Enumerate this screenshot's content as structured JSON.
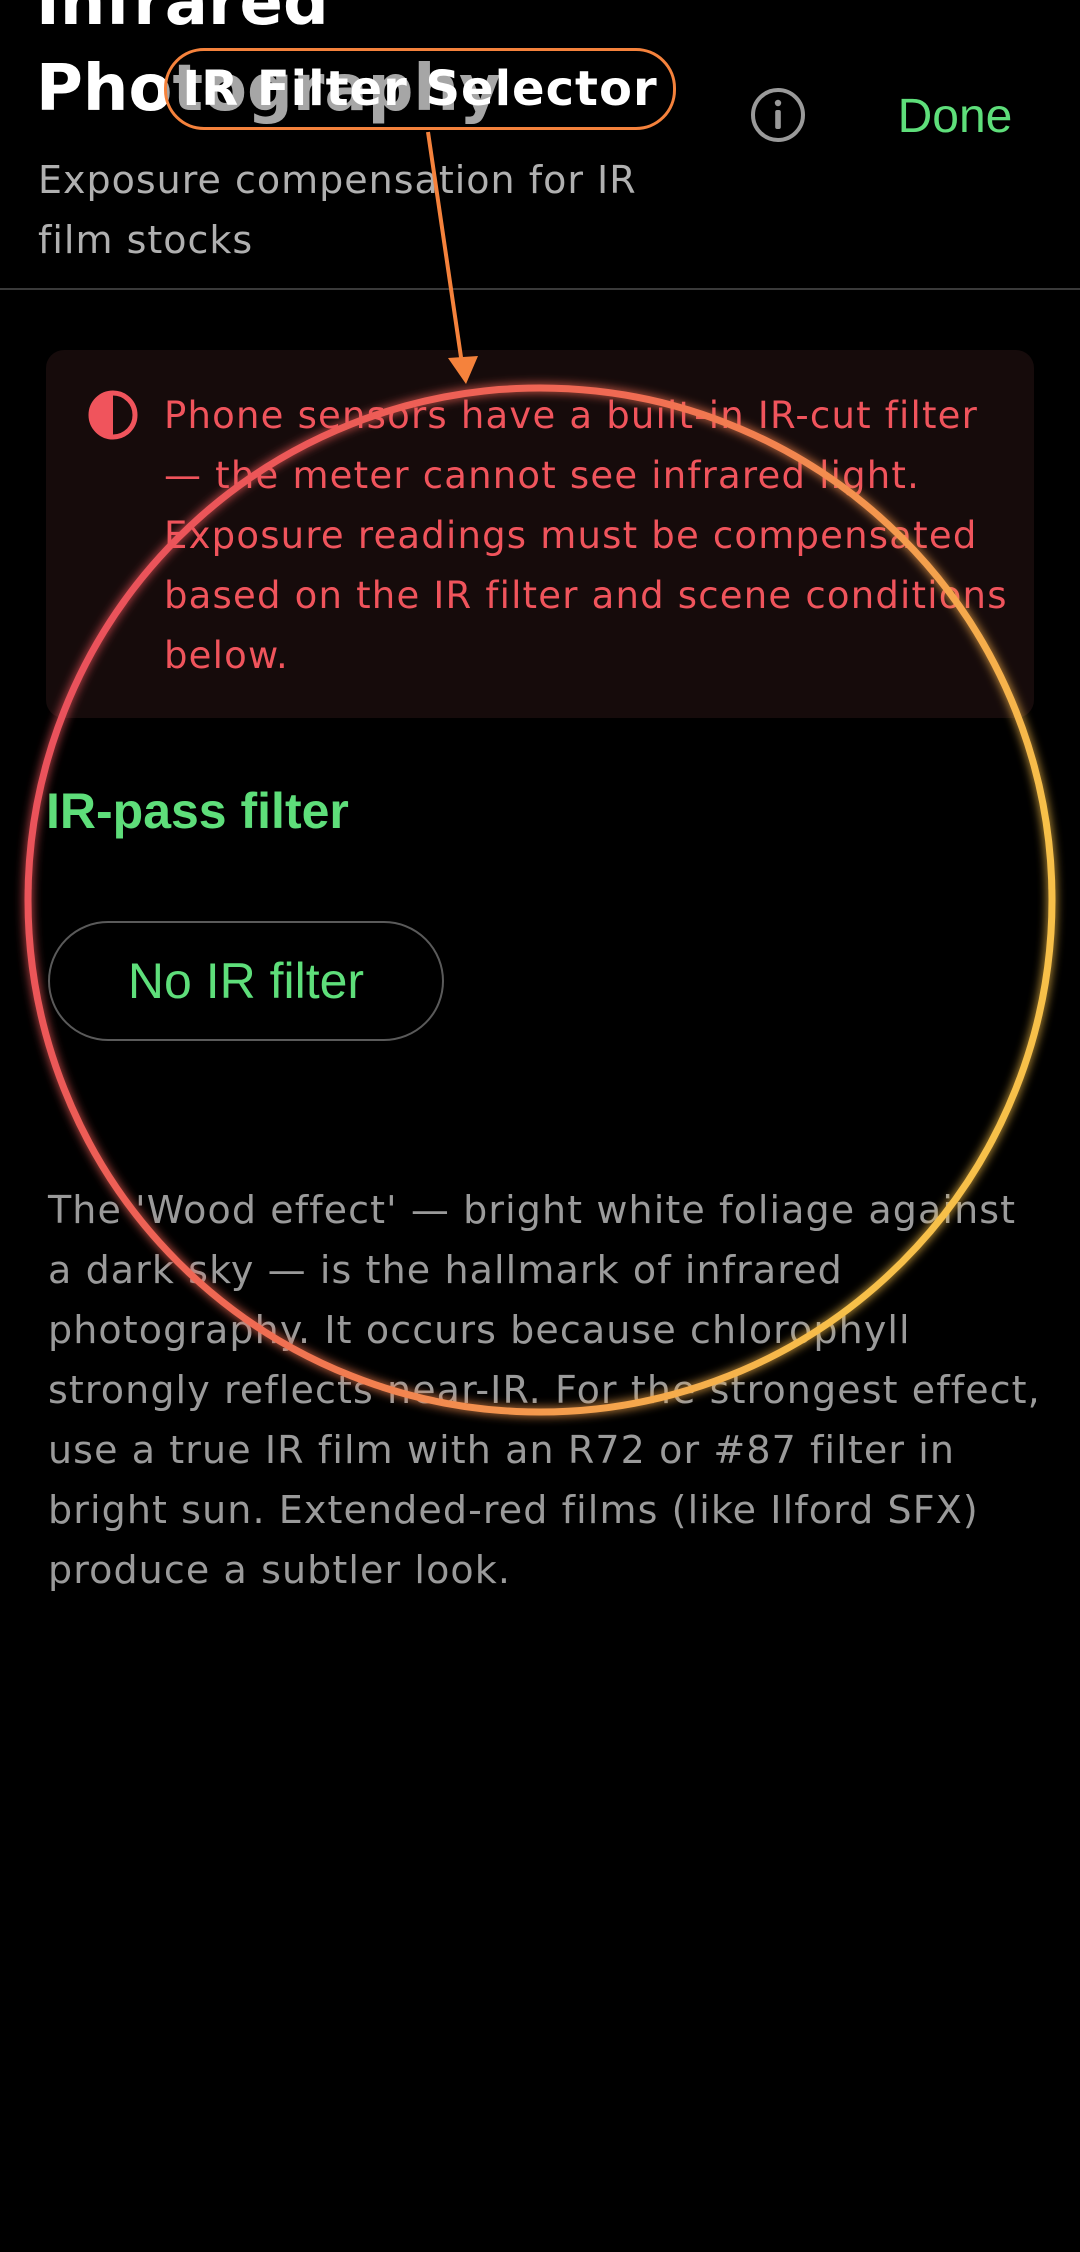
{
  "header": {
    "title": "Infrared Photography",
    "subtitle": "Exposure compensation for IR film stocks",
    "done_label": "Done"
  },
  "warning": {
    "text": "Phone sensors have a built-in IR-cut filter — the meter cannot see infrared light. Exposure readings must be compensated based on the IR filter and scene conditions below."
  },
  "filter_section": {
    "heading": "IR-pass filter",
    "selected_option": "No IR filter"
  },
  "description": {
    "text": "The 'Wood effect' — bright white foliage against a dark sky — is the hallmark of infrared photography. It occurs because chlorophyll strongly reflects near-IR. For the strongest effect, use a true IR film with an R72 or #87 filter in bright sun. Extended-red films (like Ilford SFX) produce a subtler look."
  },
  "callout": {
    "label": "IR Filter Selector"
  },
  "icons": {
    "info": "info-icon",
    "warning": "half-circle-icon"
  },
  "colors": {
    "accent_green": "#5ede7a",
    "warning_red": "#f0545c",
    "callout_orange": "#f5823c",
    "ring_gradient_start": "#e8485e",
    "ring_gradient_end": "#f7c04a"
  }
}
